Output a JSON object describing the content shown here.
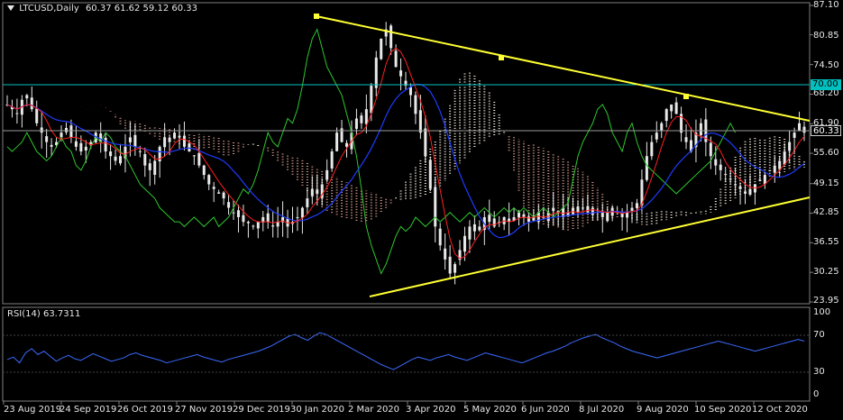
{
  "header": {
    "symbol_title": "LTCUSD,Daily",
    "ohlc": "60.37 61.62 59.12 60.33",
    "rsi_label": "RSI(14) 63.7311"
  },
  "levels": {
    "horizontal_line": "70.00",
    "current_price": "60.33"
  },
  "y_ticks": [
    "87.10",
    "80.85",
    "74.50",
    "68.20",
    "61.90",
    "55.60",
    "49.15",
    "42.85",
    "36.55",
    "30.25",
    "23.95"
  ],
  "rsi_ticks": [
    "100",
    "70",
    "30",
    "0"
  ],
  "x_ticks": [
    "23 Aug 2019",
    "24 Sep 2019",
    "26 Oct 2019",
    "27 Nov 2019",
    "29 Dec 2019",
    "30 Jan 2020",
    "2 Mar 2020",
    "3 Apr 2020",
    "5 May 2020",
    "6 Jun 2020",
    "8 Jul 2020",
    "9 Aug 2020",
    "10 Sep 2020",
    "12 Oct 2020"
  ],
  "colors": {
    "background": "#000000",
    "candles": "#e8e8e8",
    "tenkan": "#ff2020",
    "kijun": "#1e3cff",
    "chikou": "#2ec72e",
    "kumo_bull": "#f0e6d8",
    "kumo_bear": "#d49a8a",
    "triangle": "#ffff33",
    "hline": "#00c0c0",
    "rsi": "#3a6bff",
    "grid": "#808080"
  },
  "chart_data": {
    "type": "candlestick",
    "ylim": [
      23.95,
      87.1
    ],
    "close": [
      66,
      65,
      64,
      67,
      68,
      65,
      62,
      60,
      58,
      57,
      58,
      60,
      61,
      59,
      57,
      56,
      57,
      58,
      60,
      58,
      56,
      55,
      54,
      55,
      57,
      59,
      57,
      56,
      53,
      52,
      54,
      57,
      59,
      58,
      60,
      59,
      57,
      56,
      55,
      53,
      51,
      49,
      48,
      47,
      46,
      44,
      43,
      42,
      41,
      41,
      40,
      41,
      42,
      41,
      40,
      41,
      42,
      40,
      41,
      42,
      44,
      46,
      48,
      47,
      49,
      52,
      56,
      60,
      58,
      57,
      60,
      63,
      62,
      65,
      70,
      76,
      80,
      82,
      78,
      74,
      72,
      70,
      68,
      64,
      60,
      55,
      48,
      40,
      36,
      33,
      30,
      32,
      35,
      38,
      40,
      39,
      40,
      42,
      41,
      40,
      41,
      42,
      41,
      42,
      43,
      42,
      41,
      42,
      43,
      42,
      43,
      44,
      43,
      42,
      43,
      44,
      43,
      44,
      43,
      44,
      43,
      42,
      43,
      44,
      43,
      42,
      43,
      44,
      45,
      50,
      55,
      58,
      60,
      62,
      65,
      66,
      64,
      60,
      58,
      56,
      60,
      62,
      58,
      55,
      53,
      52,
      51,
      50,
      49,
      48,
      47,
      48,
      49,
      50,
      51,
      52,
      53,
      54,
      56,
      58,
      60,
      62,
      60
    ],
    "rsi": [
      42,
      45,
      38,
      50,
      55,
      48,
      52,
      46,
      40,
      44,
      47,
      43,
      41,
      45,
      49,
      46,
      43,
      40,
      42,
      44,
      48,
      50,
      47,
      45,
      43,
      41,
      38,
      40,
      42,
      44,
      46,
      48,
      45,
      43,
      41,
      39,
      42,
      44,
      46,
      48,
      50,
      52,
      55,
      58,
      62,
      66,
      70,
      72,
      68,
      65,
      70,
      74,
      72,
      68,
      64,
      60,
      56,
      52,
      48,
      44,
      40,
      36,
      33,
      30,
      34,
      38,
      42,
      45,
      43,
      41,
      44,
      46,
      48,
      45,
      43,
      41,
      44,
      47,
      50,
      48,
      46,
      44,
      42,
      40,
      38,
      41,
      44,
      47,
      50,
      52,
      55,
      58,
      62,
      65,
      68,
      70,
      72,
      68,
      65,
      62,
      58,
      55,
      52,
      50,
      48,
      46,
      44,
      46,
      48,
      50,
      52,
      54,
      56,
      58,
      60,
      62,
      64,
      62,
      60,
      58,
      56,
      54,
      52,
      54,
      56,
      58,
      60,
      62,
      64,
      66,
      64
    ]
  }
}
